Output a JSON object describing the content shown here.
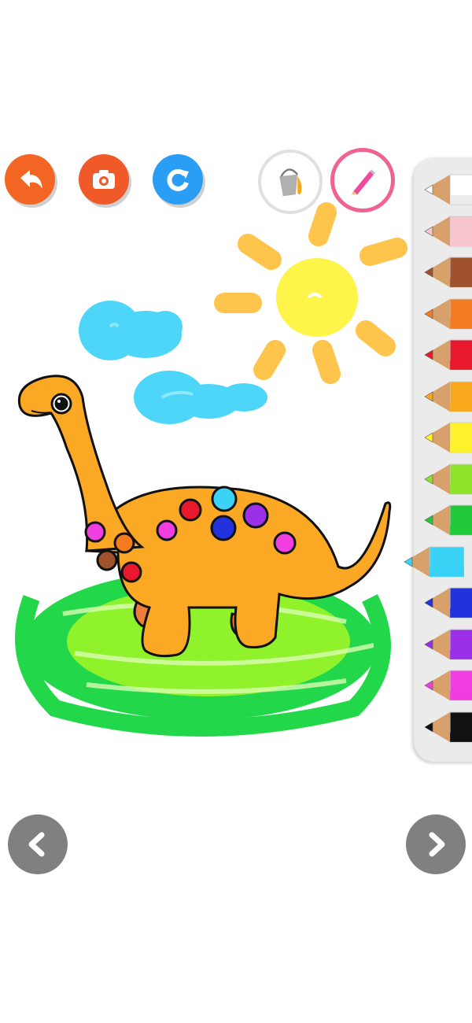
{
  "toolbar": {
    "buttons": [
      {
        "name": "back-button",
        "icon": "undo-arrow-icon",
        "color": "#f26522"
      },
      {
        "name": "screenshot-button",
        "icon": "camera-icon",
        "color": "#f05a28"
      },
      {
        "name": "redo-button",
        "icon": "redo-arrow-icon",
        "color": "#2a9df4"
      },
      {
        "name": "fill-bucket-button",
        "icon": "paint-bucket-icon",
        "color": "#ffffff",
        "selected": false
      },
      {
        "name": "pencil-tool-button",
        "icon": "pencil-icon",
        "color": "#ffffff",
        "selected": true,
        "ring": "#f06292"
      }
    ]
  },
  "palette": {
    "colors": [
      "#ffffff",
      "#f7c6cf",
      "#a0522d",
      "#f47b20",
      "#e8192c",
      "#f8a81a",
      "#fff12b",
      "#8fe32a",
      "#22c93b",
      "#3ad2f5",
      "#2233dd",
      "#9b30e8",
      "#f03ee0",
      "#111111"
    ],
    "selected_index": 9
  },
  "drawing": {
    "subject": "dinosaur",
    "body_color": "#fba925",
    "foot_color": "#ef7d3c",
    "grass_colors": [
      "#22d84a",
      "#8ff22a"
    ],
    "cloud_color": "#4dd6f7",
    "sun_color": "#fff44a",
    "ray_color": "#ffc44c"
  },
  "navigation": {
    "prev_icon": "chevron-left-icon",
    "next_icon": "chevron-right-icon",
    "color": "#808080"
  }
}
